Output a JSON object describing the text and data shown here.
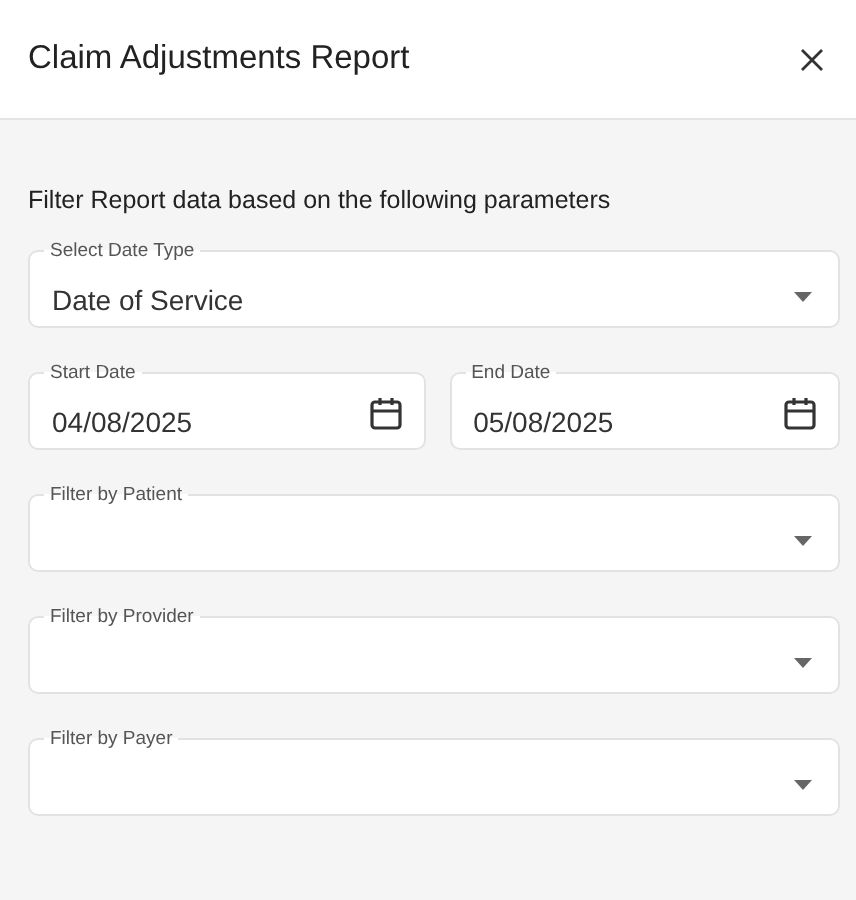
{
  "dialog": {
    "title": "Claim Adjustments Report"
  },
  "intro": "Filter Report data based on the following parameters",
  "rows": [
    [
      {
        "kind": "select",
        "label": "Select Date Type",
        "value": "Date of Service"
      }
    ],
    [
      {
        "kind": "date",
        "label": "Start Date",
        "value": "04/08/2025"
      },
      {
        "kind": "date",
        "label": "End Date",
        "value": "05/08/2025"
      }
    ],
    [
      {
        "kind": "select",
        "label": "Filter by Patient"
      }
    ],
    [
      {
        "kind": "select",
        "label": "Filter by Provider"
      }
    ],
    [
      {
        "kind": "select",
        "label": "Filter by Payer"
      }
    ]
  ]
}
